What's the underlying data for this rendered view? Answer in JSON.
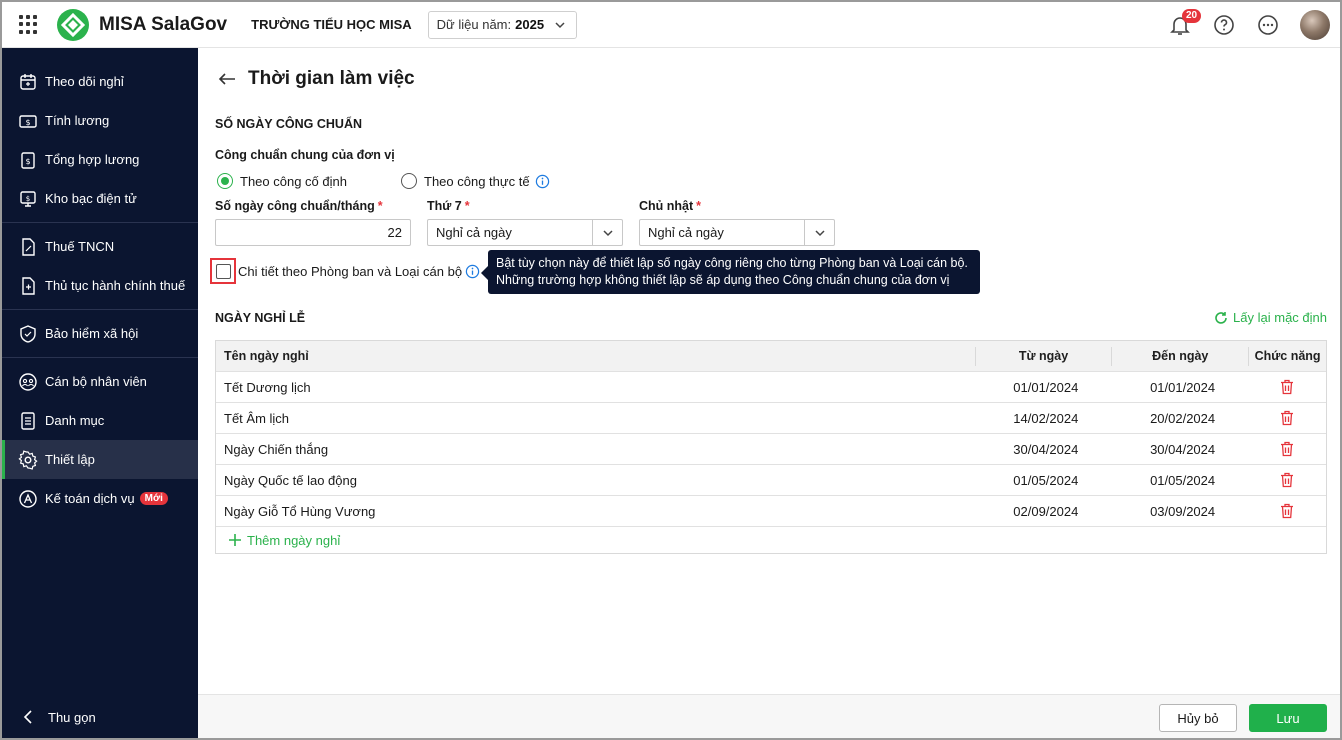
{
  "header": {
    "app_name": "MISA SalaGov",
    "org_name": "TRƯỜNG TIỂU HỌC MISA",
    "year_label": "Dữ liệu năm:",
    "year_value": "2025",
    "notification_count": "20"
  },
  "sidebar": {
    "items": [
      {
        "label": "Theo dõi nghỉ",
        "icon": "calendar-icon"
      },
      {
        "label": "Tính lương",
        "icon": "money-icon"
      },
      {
        "label": "Tổng hợp lương",
        "icon": "payroll-icon"
      },
      {
        "label": "Kho bạc điện tử",
        "icon": "treasury-icon"
      },
      {
        "label": "Thuế TNCN",
        "icon": "tax-icon"
      },
      {
        "label": "Thủ tục hành chính thuế",
        "icon": "procedure-icon"
      },
      {
        "label": "Bảo hiểm xã hội",
        "icon": "shield-icon"
      },
      {
        "label": "Cán bộ nhân viên",
        "icon": "staff-icon"
      },
      {
        "label": "Danh mục",
        "icon": "list-icon"
      },
      {
        "label": "Thiết lập",
        "icon": "gear-icon"
      },
      {
        "label": "Kế toán dịch vụ",
        "icon": "accounting-icon",
        "badge": "Mới"
      }
    ],
    "collapse_label": "Thu gọn"
  },
  "page": {
    "title": "Thời gian làm việc",
    "section_standard": "SỐ NGÀY CÔNG CHUẨN",
    "general_label": "Công chuẩn chung của đơn vị",
    "radio_fixed": "Theo công cố định",
    "radio_actual": "Theo công thực tế",
    "days_label": "Số ngày công chuẩn/tháng",
    "days_value": "22",
    "saturday_label": "Thứ 7",
    "saturday_value": "Nghỉ cả ngày",
    "sunday_label": "Chủ nhật",
    "sunday_value": "Nghỉ cả ngày",
    "required_mark": "*",
    "detail_checkbox_label": "Chi tiết theo Phòng ban và Loại cán bộ",
    "tooltip_line1": "Bật tùy chọn này để thiết lập số ngày công riêng cho từng Phòng ban và Loại cán bộ.",
    "tooltip_line2": "Những trường hợp không thiết lập sẽ áp dụng theo Công chuẩn chung của đơn vị",
    "section_holidays": "NGÀY NGHỈ LỄ",
    "reset_label": "Lấy lại mặc định"
  },
  "table": {
    "headers": {
      "name": "Tên ngày nghỉ",
      "from": "Từ ngày",
      "to": "Đến ngày",
      "actions": "Chức năng"
    },
    "rows": [
      {
        "name": "Tết Dương lịch",
        "from": "01/01/2024",
        "to": "01/01/2024"
      },
      {
        "name": "Tết Âm lịch",
        "from": "14/02/2024",
        "to": "20/02/2024"
      },
      {
        "name": "Ngày Chiến thắng",
        "from": "30/04/2024",
        "to": "30/04/2024"
      },
      {
        "name": "Ngày Quốc tế lao động",
        "from": "01/05/2024",
        "to": "01/05/2024"
      },
      {
        "name": "Ngày Giỗ Tổ Hùng Vương",
        "from": "02/09/2024",
        "to": "03/09/2024"
      }
    ],
    "add_label": "Thêm ngày nghỉ"
  },
  "footer": {
    "cancel_label": "Hủy bỏ",
    "save_label": "Lưu"
  },
  "colors": {
    "accent": "#2bb24c",
    "sidebar_bg": "#0b1530",
    "danger": "#e5343b"
  }
}
